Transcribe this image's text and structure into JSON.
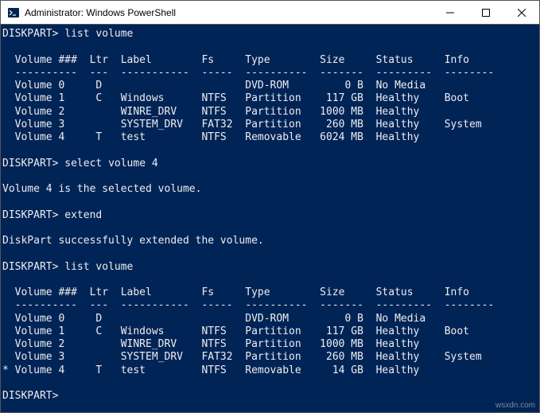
{
  "window": {
    "title": "Administrator: Windows PowerShell",
    "icon": "powershell-icon"
  },
  "terminal": {
    "prompts": {
      "p1": {
        "prompt": "DISKPART>",
        "cmd": "list volume"
      },
      "p2": {
        "prompt": "DISKPART>",
        "cmd": "select volume 4"
      },
      "msg_selected": "Volume 4 is the selected volume.",
      "p3": {
        "prompt": "DISKPART>",
        "cmd": "extend"
      },
      "msg_extended": "DiskPart successfully extended the volume.",
      "p4": {
        "prompt": "DISKPART>",
        "cmd": "list volume"
      },
      "p5": {
        "prompt": "DISKPART>",
        "cmd": ""
      }
    },
    "table1": {
      "header": "  Volume ###  Ltr  Label        Fs     Type        Size     Status     Info",
      "sep": "  ----------  ---  -----------  -----  ----------  -------  ---------  --------",
      "rows": [
        "  Volume 0     D                       DVD-ROM         0 B  No Media",
        "  Volume 1     C   Windows      NTFS   Partition    117 GB  Healthy    Boot",
        "  Volume 2         WINRE_DRV    NTFS   Partition   1000 MB  Healthy",
        "  Volume 3         SYSTEM_DRV   FAT32  Partition    260 MB  Healthy    System",
        "  Volume 4     T   test         NTFS   Removable   6024 MB  Healthy"
      ]
    },
    "table2": {
      "header": "  Volume ###  Ltr  Label        Fs     Type        Size     Status     Info",
      "sep": "  ----------  ---  -----------  -----  ----------  -------  ---------  --------",
      "rows": [
        "  Volume 0     D                       DVD-ROM         0 B  No Media",
        "  Volume 1     C   Windows      NTFS   Partition    117 GB  Healthy    Boot",
        "  Volume 2         WINRE_DRV    NTFS   Partition   1000 MB  Healthy",
        "  Volume 3         SYSTEM_DRV   FAT32  Partition    260 MB  Healthy    System",
        "* Volume 4     T   test         NTFS   Removable     14 GB  Healthy"
      ]
    }
  },
  "watermark": "wsxdn.com"
}
